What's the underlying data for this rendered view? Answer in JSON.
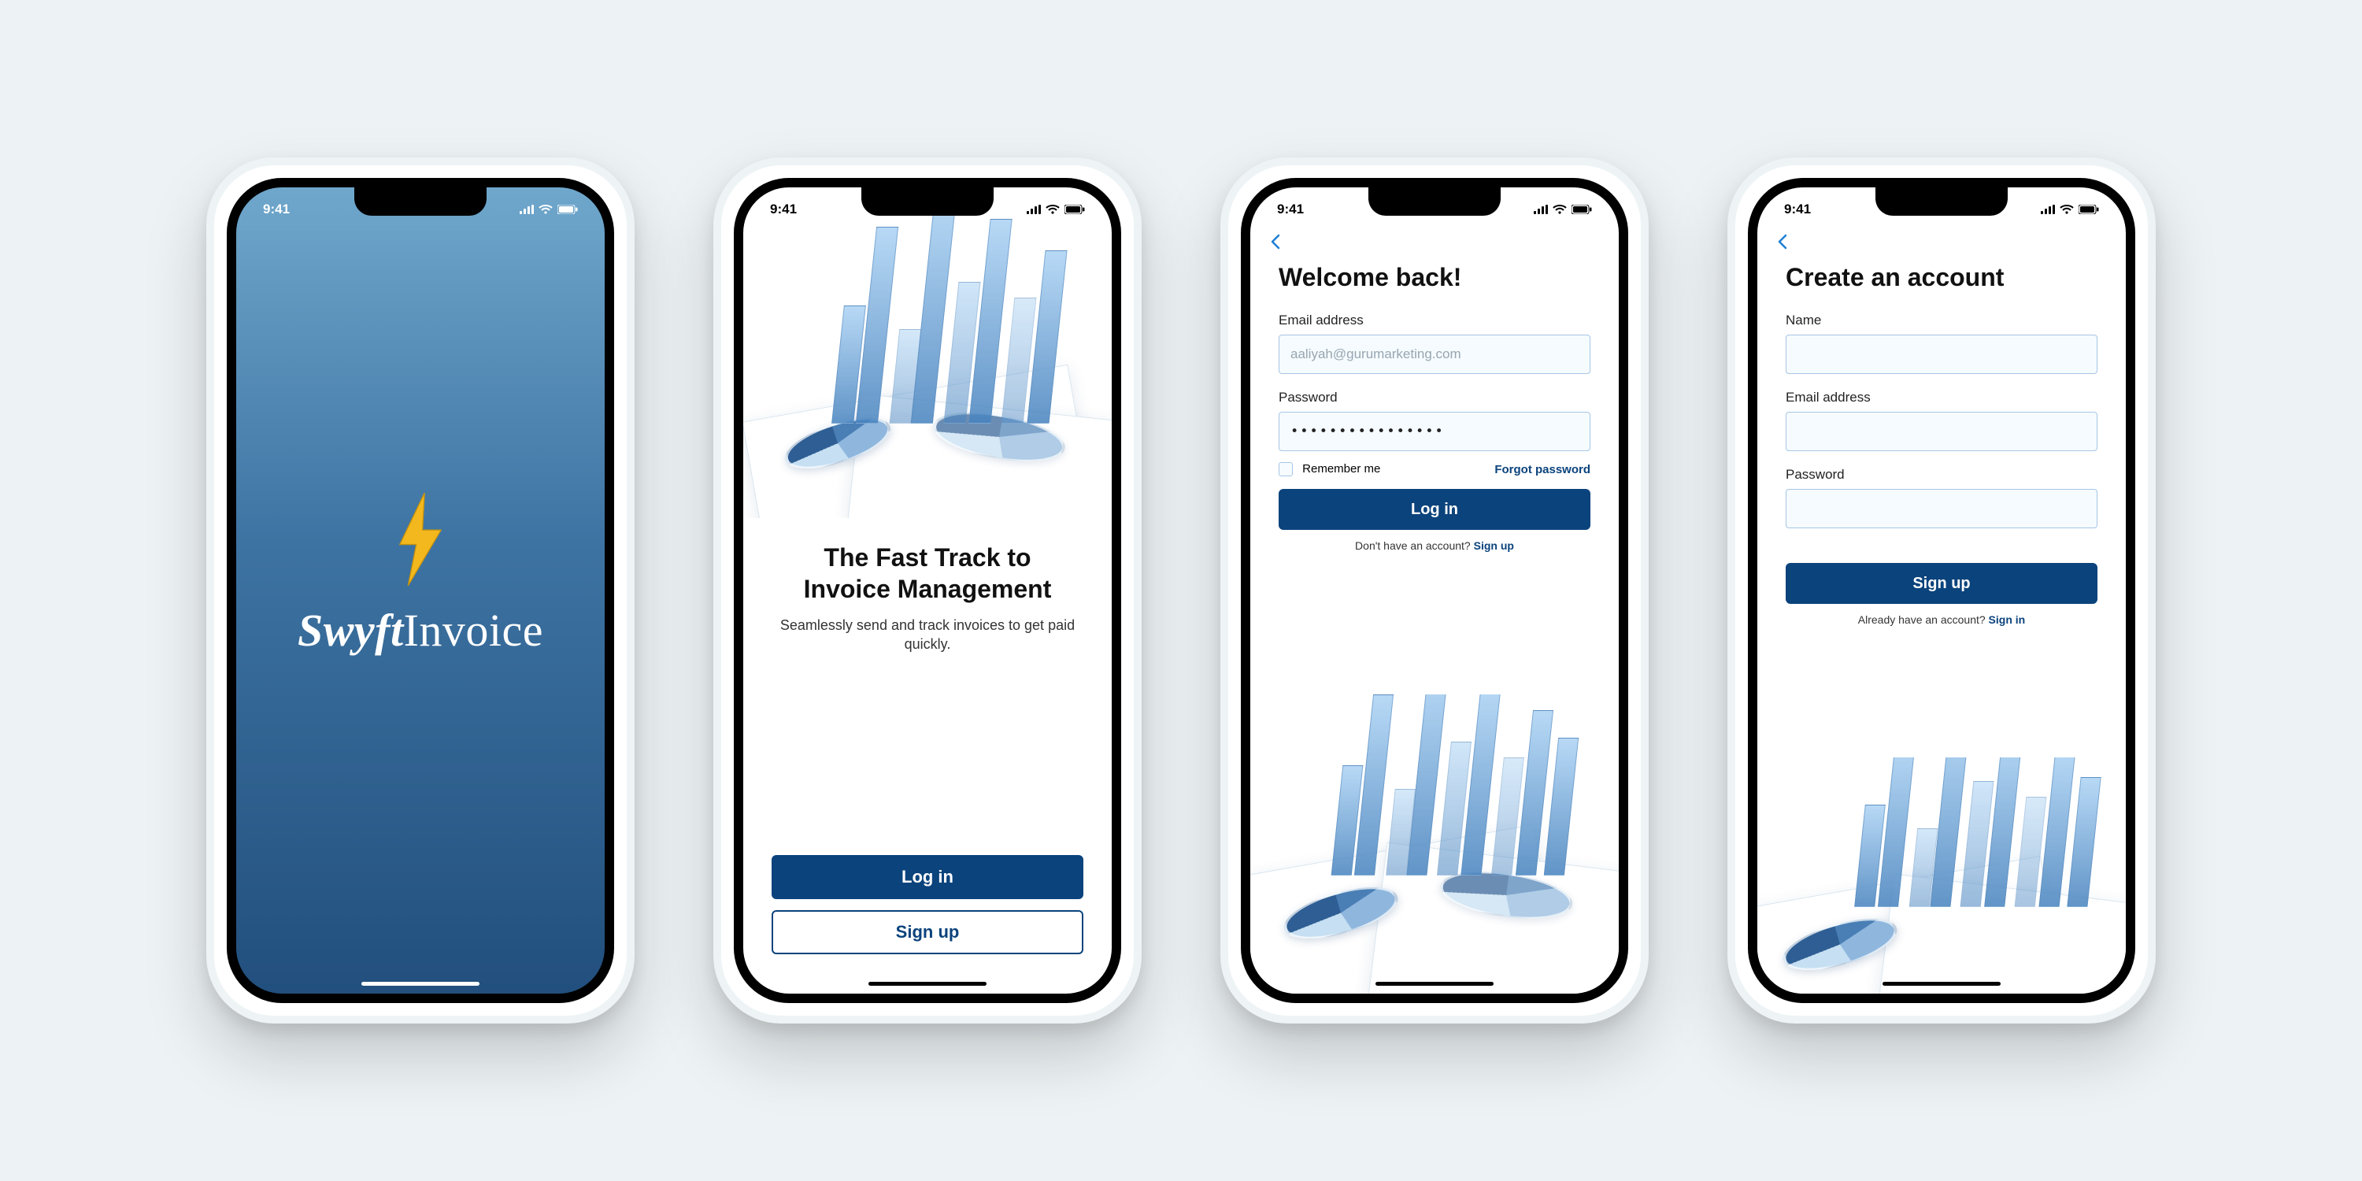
{
  "status": {
    "time": "9:41"
  },
  "brand": {
    "name_bold": "Swyft",
    "name_rest": "Invoice",
    "logo_icon": "lightning-bolt-icon"
  },
  "onboarding": {
    "headline_line1": "The Fast Track to",
    "headline_line2": "Invoice Management",
    "subtitle": "Seamlessly send and track invoices to get paid quickly.",
    "login_label": "Log in",
    "signup_label": "Sign up"
  },
  "login": {
    "heading": "Welcome back!",
    "email_label": "Email address",
    "email_placeholder": "aaliyah@gurumarketing.com",
    "password_label": "Password",
    "password_value": "••••••••••••••••",
    "remember_label": "Remember me",
    "forgot_label": "Forgot password",
    "submit_label": "Log in",
    "alt_prompt": "Don't have an account? ",
    "alt_action": "Sign up"
  },
  "signup": {
    "heading": "Create an account",
    "name_label": "Name",
    "email_label": "Email address",
    "password_label": "Password",
    "submit_label": "Sign up",
    "alt_prompt": "Already have an account? ",
    "alt_action": "Sign in"
  }
}
